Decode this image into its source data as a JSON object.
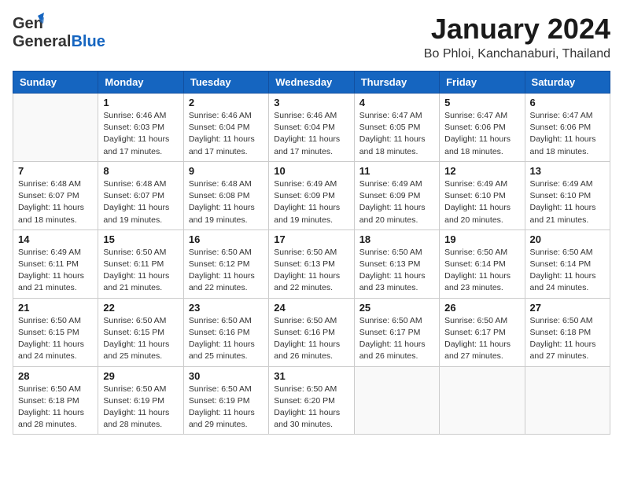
{
  "header": {
    "logo_general": "General",
    "logo_blue": "Blue",
    "month_title": "January 2024",
    "location": "Bo Phloi, Kanchanaburi, Thailand"
  },
  "weekdays": [
    "Sunday",
    "Monday",
    "Tuesday",
    "Wednesday",
    "Thursday",
    "Friday",
    "Saturday"
  ],
  "weeks": [
    [
      {
        "day": "",
        "sunrise": "",
        "sunset": "",
        "daylight": ""
      },
      {
        "day": "1",
        "sunrise": "Sunrise: 6:46 AM",
        "sunset": "Sunset: 6:03 PM",
        "daylight": "Daylight: 11 hours and 17 minutes."
      },
      {
        "day": "2",
        "sunrise": "Sunrise: 6:46 AM",
        "sunset": "Sunset: 6:04 PM",
        "daylight": "Daylight: 11 hours and 17 minutes."
      },
      {
        "day": "3",
        "sunrise": "Sunrise: 6:46 AM",
        "sunset": "Sunset: 6:04 PM",
        "daylight": "Daylight: 11 hours and 17 minutes."
      },
      {
        "day": "4",
        "sunrise": "Sunrise: 6:47 AM",
        "sunset": "Sunset: 6:05 PM",
        "daylight": "Daylight: 11 hours and 18 minutes."
      },
      {
        "day": "5",
        "sunrise": "Sunrise: 6:47 AM",
        "sunset": "Sunset: 6:06 PM",
        "daylight": "Daylight: 11 hours and 18 minutes."
      },
      {
        "day": "6",
        "sunrise": "Sunrise: 6:47 AM",
        "sunset": "Sunset: 6:06 PM",
        "daylight": "Daylight: 11 hours and 18 minutes."
      }
    ],
    [
      {
        "day": "7",
        "sunrise": "Sunrise: 6:48 AM",
        "sunset": "Sunset: 6:07 PM",
        "daylight": "Daylight: 11 hours and 18 minutes."
      },
      {
        "day": "8",
        "sunrise": "Sunrise: 6:48 AM",
        "sunset": "Sunset: 6:07 PM",
        "daylight": "Daylight: 11 hours and 19 minutes."
      },
      {
        "day": "9",
        "sunrise": "Sunrise: 6:48 AM",
        "sunset": "Sunset: 6:08 PM",
        "daylight": "Daylight: 11 hours and 19 minutes."
      },
      {
        "day": "10",
        "sunrise": "Sunrise: 6:49 AM",
        "sunset": "Sunset: 6:09 PM",
        "daylight": "Daylight: 11 hours and 19 minutes."
      },
      {
        "day": "11",
        "sunrise": "Sunrise: 6:49 AM",
        "sunset": "Sunset: 6:09 PM",
        "daylight": "Daylight: 11 hours and 20 minutes."
      },
      {
        "day": "12",
        "sunrise": "Sunrise: 6:49 AM",
        "sunset": "Sunset: 6:10 PM",
        "daylight": "Daylight: 11 hours and 20 minutes."
      },
      {
        "day": "13",
        "sunrise": "Sunrise: 6:49 AM",
        "sunset": "Sunset: 6:10 PM",
        "daylight": "Daylight: 11 hours and 21 minutes."
      }
    ],
    [
      {
        "day": "14",
        "sunrise": "Sunrise: 6:49 AM",
        "sunset": "Sunset: 6:11 PM",
        "daylight": "Daylight: 11 hours and 21 minutes."
      },
      {
        "day": "15",
        "sunrise": "Sunrise: 6:50 AM",
        "sunset": "Sunset: 6:11 PM",
        "daylight": "Daylight: 11 hours and 21 minutes."
      },
      {
        "day": "16",
        "sunrise": "Sunrise: 6:50 AM",
        "sunset": "Sunset: 6:12 PM",
        "daylight": "Daylight: 11 hours and 22 minutes."
      },
      {
        "day": "17",
        "sunrise": "Sunrise: 6:50 AM",
        "sunset": "Sunset: 6:13 PM",
        "daylight": "Daylight: 11 hours and 22 minutes."
      },
      {
        "day": "18",
        "sunrise": "Sunrise: 6:50 AM",
        "sunset": "Sunset: 6:13 PM",
        "daylight": "Daylight: 11 hours and 23 minutes."
      },
      {
        "day": "19",
        "sunrise": "Sunrise: 6:50 AM",
        "sunset": "Sunset: 6:14 PM",
        "daylight": "Daylight: 11 hours and 23 minutes."
      },
      {
        "day": "20",
        "sunrise": "Sunrise: 6:50 AM",
        "sunset": "Sunset: 6:14 PM",
        "daylight": "Daylight: 11 hours and 24 minutes."
      }
    ],
    [
      {
        "day": "21",
        "sunrise": "Sunrise: 6:50 AM",
        "sunset": "Sunset: 6:15 PM",
        "daylight": "Daylight: 11 hours and 24 minutes."
      },
      {
        "day": "22",
        "sunrise": "Sunrise: 6:50 AM",
        "sunset": "Sunset: 6:15 PM",
        "daylight": "Daylight: 11 hours and 25 minutes."
      },
      {
        "day": "23",
        "sunrise": "Sunrise: 6:50 AM",
        "sunset": "Sunset: 6:16 PM",
        "daylight": "Daylight: 11 hours and 25 minutes."
      },
      {
        "day": "24",
        "sunrise": "Sunrise: 6:50 AM",
        "sunset": "Sunset: 6:16 PM",
        "daylight": "Daylight: 11 hours and 26 minutes."
      },
      {
        "day": "25",
        "sunrise": "Sunrise: 6:50 AM",
        "sunset": "Sunset: 6:17 PM",
        "daylight": "Daylight: 11 hours and 26 minutes."
      },
      {
        "day": "26",
        "sunrise": "Sunrise: 6:50 AM",
        "sunset": "Sunset: 6:17 PM",
        "daylight": "Daylight: 11 hours and 27 minutes."
      },
      {
        "day": "27",
        "sunrise": "Sunrise: 6:50 AM",
        "sunset": "Sunset: 6:18 PM",
        "daylight": "Daylight: 11 hours and 27 minutes."
      }
    ],
    [
      {
        "day": "28",
        "sunrise": "Sunrise: 6:50 AM",
        "sunset": "Sunset: 6:18 PM",
        "daylight": "Daylight: 11 hours and 28 minutes."
      },
      {
        "day": "29",
        "sunrise": "Sunrise: 6:50 AM",
        "sunset": "Sunset: 6:19 PM",
        "daylight": "Daylight: 11 hours and 28 minutes."
      },
      {
        "day": "30",
        "sunrise": "Sunrise: 6:50 AM",
        "sunset": "Sunset: 6:19 PM",
        "daylight": "Daylight: 11 hours and 29 minutes."
      },
      {
        "day": "31",
        "sunrise": "Sunrise: 6:50 AM",
        "sunset": "Sunset: 6:20 PM",
        "daylight": "Daylight: 11 hours and 30 minutes."
      },
      {
        "day": "",
        "sunrise": "",
        "sunset": "",
        "daylight": ""
      },
      {
        "day": "",
        "sunrise": "",
        "sunset": "",
        "daylight": ""
      },
      {
        "day": "",
        "sunrise": "",
        "sunset": "",
        "daylight": ""
      }
    ]
  ]
}
